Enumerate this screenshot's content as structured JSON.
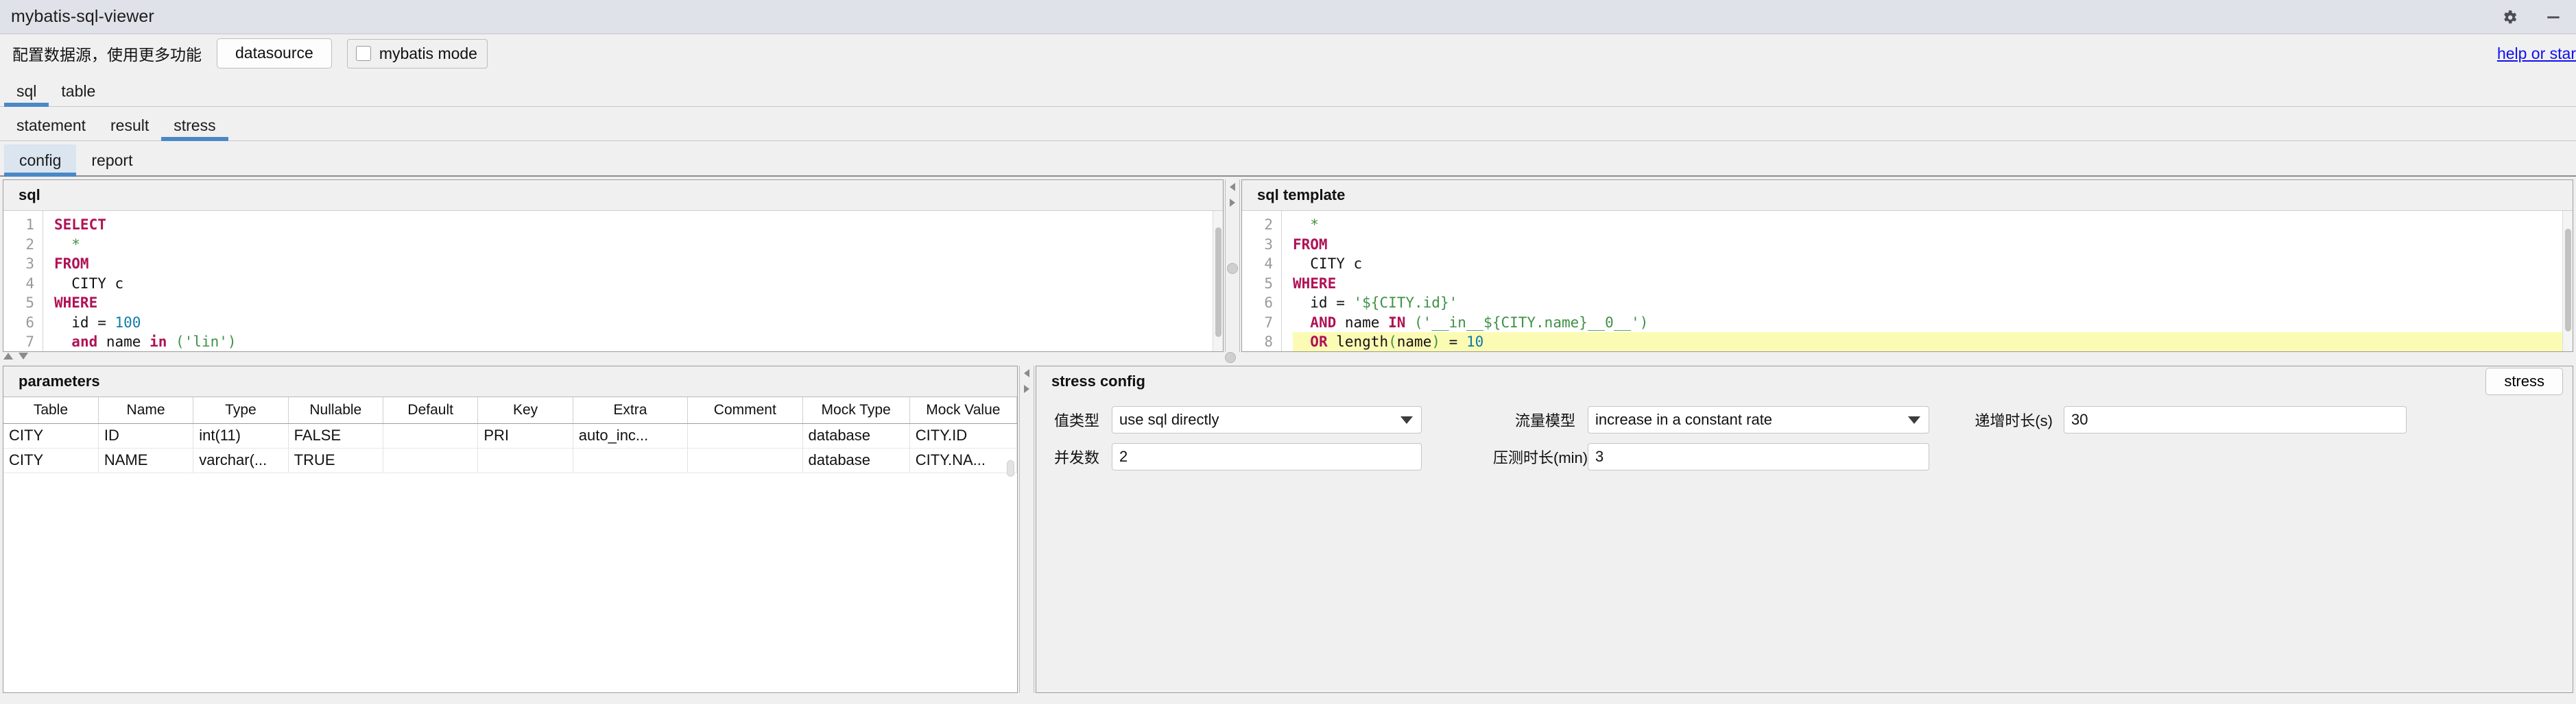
{
  "window": {
    "title": "mybatis-sql-viewer",
    "settings_icon": "gear-icon",
    "minimize_icon": "minimize-icon"
  },
  "toolbar": {
    "hint": "配置数据源，使用更多功能",
    "datasource_label": "datasource",
    "mybatis_mode_label": "mybatis mode",
    "mybatis_mode_checked": false,
    "help_link": "help or star"
  },
  "tabs_level1": [
    {
      "label": "sql",
      "selected": true
    },
    {
      "label": "table",
      "selected": false
    }
  ],
  "tabs_level2": [
    {
      "label": "statement",
      "selected": false
    },
    {
      "label": "result",
      "selected": false
    },
    {
      "label": "stress",
      "selected": true
    }
  ],
  "tabs_level3": [
    {
      "label": "config",
      "selected": true
    },
    {
      "label": "report",
      "selected": false
    }
  ],
  "sql_panel": {
    "title": "sql",
    "lines": [
      {
        "n": "1",
        "tokens": [
          {
            "t": "SELECT",
            "c": "kw"
          }
        ]
      },
      {
        "n": "2",
        "tokens": [
          {
            "t": "  ",
            "c": "plain"
          },
          {
            "t": "*",
            "c": "str"
          }
        ]
      },
      {
        "n": "3",
        "tokens": [
          {
            "t": "FROM",
            "c": "kw"
          }
        ]
      },
      {
        "n": "4",
        "tokens": [
          {
            "t": "  CITY c",
            "c": "plain"
          }
        ]
      },
      {
        "n": "5",
        "tokens": [
          {
            "t": "WHERE",
            "c": "kw"
          }
        ]
      },
      {
        "n": "6",
        "tokens": [
          {
            "t": "  id = ",
            "c": "plain"
          },
          {
            "t": "100",
            "c": "num"
          }
        ]
      },
      {
        "n": "7",
        "tokens": [
          {
            "t": "  ",
            "c": "plain"
          },
          {
            "t": "and",
            "c": "kw"
          },
          {
            "t": " name ",
            "c": "plain"
          },
          {
            "t": "in",
            "c": "kw"
          },
          {
            "t": " (",
            "c": "str"
          },
          {
            "t": "'lin'",
            "c": "str"
          },
          {
            "t": ")",
            "c": "str"
          }
        ]
      }
    ]
  },
  "template_panel": {
    "title": "sql template",
    "lines": [
      {
        "n": "2",
        "hl": false,
        "tokens": [
          {
            "t": "  ",
            "c": "plain"
          },
          {
            "t": "*",
            "c": "str"
          }
        ]
      },
      {
        "n": "3",
        "hl": false,
        "tokens": [
          {
            "t": "FROM",
            "c": "kw"
          }
        ]
      },
      {
        "n": "4",
        "hl": false,
        "tokens": [
          {
            "t": "  CITY c",
            "c": "plain"
          }
        ]
      },
      {
        "n": "5",
        "hl": false,
        "tokens": [
          {
            "t": "WHERE",
            "c": "kw"
          }
        ]
      },
      {
        "n": "6",
        "hl": false,
        "tokens": [
          {
            "t": "  id = ",
            "c": "plain"
          },
          {
            "t": "'${CITY.id}'",
            "c": "str"
          }
        ]
      },
      {
        "n": "7",
        "hl": false,
        "tokens": [
          {
            "t": "  ",
            "c": "plain"
          },
          {
            "t": "AND",
            "c": "kw"
          },
          {
            "t": " name ",
            "c": "plain"
          },
          {
            "t": "IN",
            "c": "kw"
          },
          {
            "t": " ('__in__${CITY.name}__0__')",
            "c": "str"
          }
        ]
      },
      {
        "n": "8",
        "hl": true,
        "tokens": [
          {
            "t": "  ",
            "c": "plain"
          },
          {
            "t": "OR",
            "c": "kw"
          },
          {
            "t": " length",
            "c": "plain"
          },
          {
            "t": "(",
            "c": "str"
          },
          {
            "t": "name",
            "c": "plain"
          },
          {
            "t": ")",
            "c": "str"
          },
          {
            "t": " = ",
            "c": "plain"
          },
          {
            "t": "10",
            "c": "num"
          }
        ]
      }
    ]
  },
  "parameters_panel": {
    "title": "parameters",
    "columns": [
      "Table",
      "Name",
      "Type",
      "Nullable",
      "Default",
      "Key",
      "Extra",
      "Comment",
      "Mock Type",
      "Mock Value"
    ],
    "rows": [
      [
        "CITY",
        "ID",
        "int(11)",
        "FALSE",
        "",
        "PRI",
        "auto_inc...",
        "",
        "database",
        "CITY.ID"
      ],
      [
        "CITY",
        "NAME",
        "varchar(...",
        "TRUE",
        "",
        "",
        "",
        "",
        "database",
        "CITY.NA..."
      ]
    ]
  },
  "stress_panel": {
    "title": "stress config",
    "stress_button": "stress",
    "fields": {
      "value_type_label": "值类型",
      "value_type_value": "use sql directly",
      "traffic_model_label": "流量模型",
      "traffic_model_value": "increase in a constant rate",
      "ramp_up_label": "递增时长(s)",
      "ramp_up_value": "30",
      "concurrency_label": "并发数",
      "concurrency_value": "2",
      "duration_label": "压测时长(min)",
      "duration_value": "3"
    }
  },
  "colors": {
    "accent": "#4a88c7",
    "titlebar": "#e0e2e9",
    "background": "#f0f0f0",
    "keyword": "#b01256",
    "string": "#3f9146",
    "number": "#0f7ba8",
    "highlight": "#fcfbb4",
    "link": "#1010ee"
  }
}
